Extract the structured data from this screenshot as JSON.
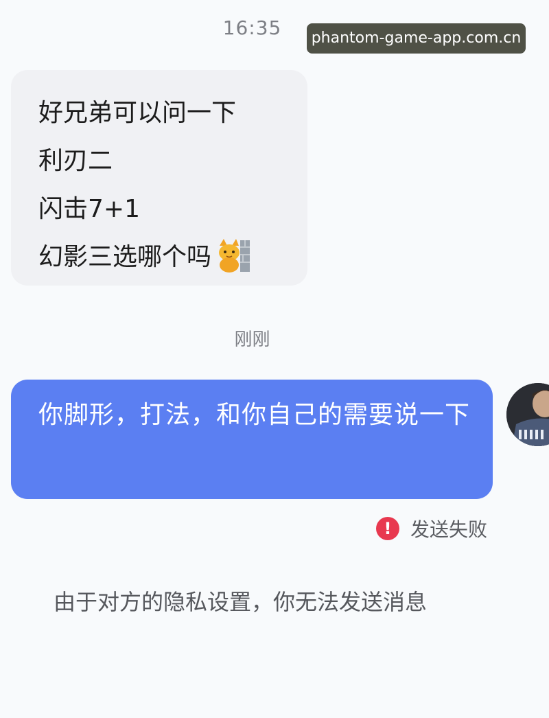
{
  "header": {
    "time": "16:35",
    "watermark": "phantom-game-app.com.cn"
  },
  "incoming_message": {
    "lines": [
      "好兄弟可以问一下",
      "利刃二",
      "闪击7+1",
      "幻影三选哪个吗"
    ],
    "emoji": "cat-peeking-emoji"
  },
  "separator_time": "刚刚",
  "outgoing_message": {
    "text": "你脚形，打法，和你自己的需要说一下",
    "status": "发送失败",
    "status_icon": "exclamation-icon"
  },
  "system_notice": "由于对方的隐私设置，你无法发送消息",
  "colors": {
    "outgoing_bubble": "#5b7ff2",
    "incoming_bubble": "#f0f1f4",
    "error": "#e8384f",
    "background": "#f8fafc"
  }
}
